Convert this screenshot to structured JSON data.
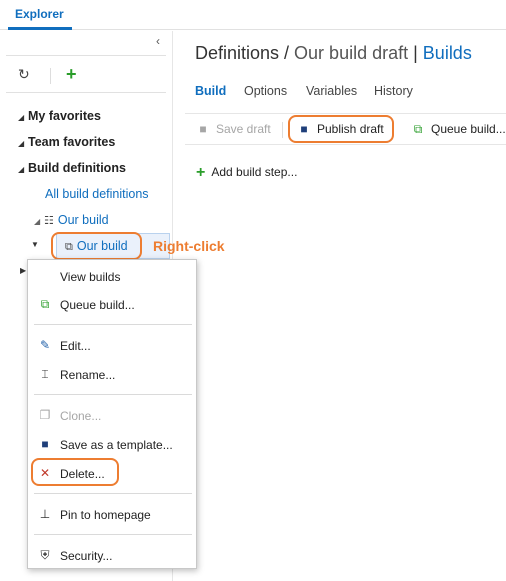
{
  "topbar": {
    "explorer_tab": "Explorer"
  },
  "icons": {
    "collapse": "chevron-left-icon",
    "refresh": "refresh-icon",
    "add": "plus-icon"
  },
  "tree": {
    "my_favorites": "My favorites",
    "team_favorites": "Team favorites",
    "build_definitions": "Build definitions",
    "all_build_definitions": "All build definitions",
    "our_build_1": "Our build",
    "our_build_2": "Our build"
  },
  "annotation": {
    "right_click": "Right-click"
  },
  "context_menu": {
    "view_builds": "View builds",
    "queue_build": "Queue build...",
    "edit": "Edit...",
    "rename": "Rename...",
    "clone": "Clone...",
    "save_as_template": "Save as a template...",
    "delete": "Delete...",
    "pin_to_homepage": "Pin to homepage",
    "security": "Security..."
  },
  "heading": {
    "part1": "Definitions / ",
    "part2": "Our build draft",
    "separator": " | ",
    "part3": "Builds"
  },
  "subtabs": {
    "build": "Build",
    "options": "Options",
    "variables": "Variables",
    "history": "History"
  },
  "commands": {
    "save_draft": "Save draft",
    "publish_draft": "Publish draft",
    "queue_build": "Queue build..."
  },
  "add_build_step": "Add build step...",
  "colors": {
    "accent": "#106ebe",
    "callout": "#ed7d31",
    "add_green": "#2a9d2a",
    "delete_red": "#c0392b"
  }
}
